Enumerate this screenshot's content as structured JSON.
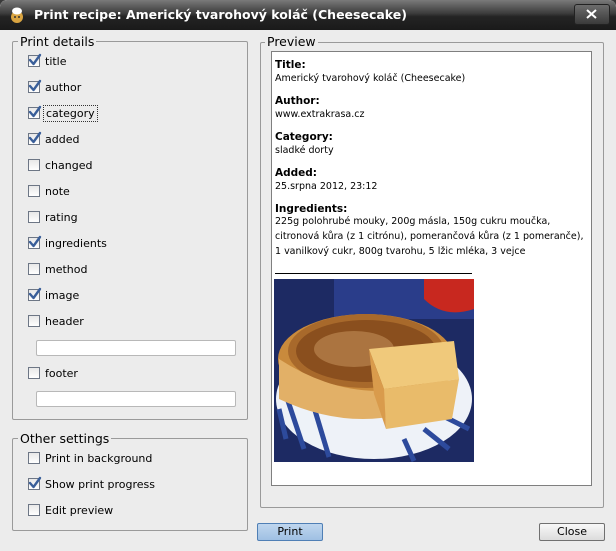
{
  "window": {
    "title": "Print recipe: Americký tvarohový koláč (Cheesecake)"
  },
  "print_details": {
    "legend": "Print details",
    "items": [
      {
        "label": "title",
        "checked": true
      },
      {
        "label": "author",
        "checked": true
      },
      {
        "label": "category",
        "checked": true
      },
      {
        "label": "added",
        "checked": true
      },
      {
        "label": "changed",
        "checked": false
      },
      {
        "label": "note",
        "checked": false
      },
      {
        "label": "rating",
        "checked": false
      },
      {
        "label": "ingredients",
        "checked": true
      },
      {
        "label": "method",
        "checked": false
      },
      {
        "label": "image",
        "checked": true
      },
      {
        "label": "header",
        "checked": false
      },
      {
        "label": "footer",
        "checked": false
      }
    ],
    "header_value": "",
    "footer_value": ""
  },
  "other_settings": {
    "legend": "Other settings",
    "items": [
      {
        "label": "Print in background",
        "checked": false
      },
      {
        "label": "Show print progress",
        "checked": true
      },
      {
        "label": "Edit preview",
        "checked": false
      }
    ]
  },
  "preview": {
    "legend": "Preview",
    "title_heading": "Title:",
    "title_value": "Americký tvarohový koláč (Cheesecake)",
    "author_heading": "Author:",
    "author_value": "www.extrakrasa.cz",
    "category_heading": "Category:",
    "category_value": "sladké dorty",
    "added_heading": "Added:",
    "added_value": "25.srpna 2012, 23:12",
    "ingredients_heading": "Ingredients:",
    "ingredients_value": "225g polohrubé mouky, 200g másla, 150g cukru moučka, citronová kůra (z 1 citrónu), pomerančová kůra (z 1 pomeranče), 1 vanilkový cukr, 800g tvarohu, 5 lžic mléka, 3 vejce"
  },
  "buttons": {
    "print_label": "Print",
    "close_label": "Close"
  },
  "colors": {
    "accent": "#336699",
    "check": "#3a5f9a"
  }
}
